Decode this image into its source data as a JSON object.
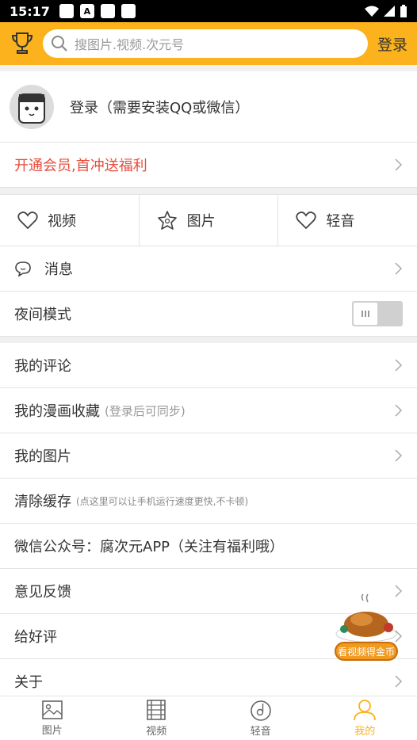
{
  "status_bar": {
    "time": "15:17",
    "icon_a": "A"
  },
  "search": {
    "placeholder": "搜图片.视频.次元号",
    "login_label": "登录"
  },
  "profile": {
    "text": "登录（需要安装QQ或微信）"
  },
  "vip": {
    "label": "开通会员,首冲送福利",
    "color": "#e74c3c"
  },
  "tabs": [
    {
      "label": "视频",
      "icon": "heart-icon"
    },
    {
      "label": "图片",
      "icon": "star-icon"
    },
    {
      "label": "轻音",
      "icon": "heart-icon"
    }
  ],
  "messages": {
    "label": "消息"
  },
  "night_mode": {
    "label": "夜间模式",
    "enabled": false
  },
  "menu": {
    "comments": "我的评论",
    "comic_fav": "我的漫画收藏",
    "comic_fav_note": "(登录后可同步)",
    "my_images": "我的图片",
    "clear_cache": "清除缓存",
    "clear_cache_note": "(点这里可以让手机运行速度更快,不卡顿)",
    "wechat": "微信公众号：腐次元APP（关注有福利哦）",
    "feedback": "意见反馈",
    "rate": "给好评",
    "about": "关于"
  },
  "float_ad": {
    "label": "看视频得金币"
  },
  "bottom_nav": [
    {
      "label": "图片",
      "icon": "image-icon"
    },
    {
      "label": "视频",
      "icon": "film-icon"
    },
    {
      "label": "轻音",
      "icon": "music-disc-icon"
    },
    {
      "label": "我的",
      "icon": "person-icon",
      "active": true
    }
  ],
  "colors": {
    "accent": "#fbb21c",
    "text": "#333333"
  }
}
